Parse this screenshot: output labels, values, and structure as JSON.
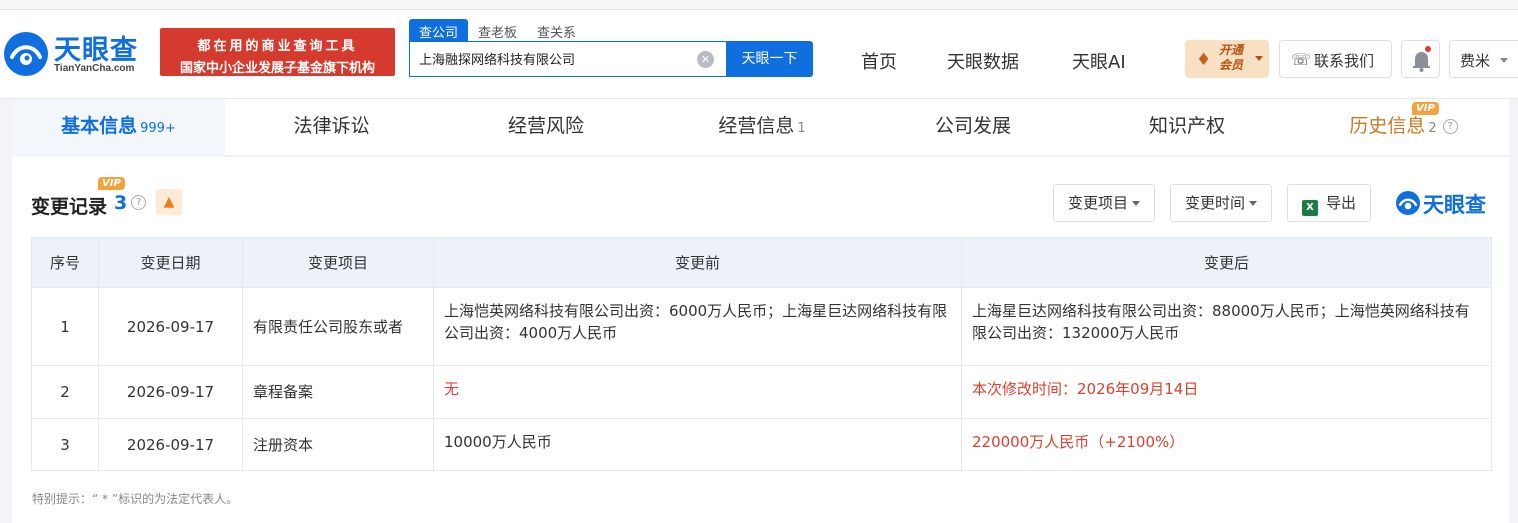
{
  "header": {
    "logo_name": "天眼查",
    "logo_url": "TianYanCha.com",
    "slogan_line1": "都在用的商业查询工具",
    "slogan_line2": "国家中小企业发展子基金旗下机构",
    "search_tabs": [
      "查公司",
      "查老板",
      "查关系"
    ],
    "search_value": "上海融探网络科技有限公司",
    "search_button": "天眼一下",
    "nav": [
      "首页",
      "天眼数据",
      "天眼AI"
    ],
    "vip_open_label": "开通会员",
    "contact_label": "联系我们",
    "user_name": "费米"
  },
  "tabs": [
    {
      "label": "基本信息",
      "count": "999+",
      "active": true
    },
    {
      "label": "法律诉讼",
      "count": ""
    },
    {
      "label": "经营风险",
      "count": ""
    },
    {
      "label": "经营信息",
      "count": "1"
    },
    {
      "label": "公司发展",
      "count": ""
    },
    {
      "label": "知识产权",
      "count": ""
    },
    {
      "label": "历史信息",
      "count": "2",
      "vip": "VIP"
    }
  ],
  "section": {
    "title": "变更记录",
    "count": "3",
    "vip": "VIP",
    "buttons": {
      "change_item": "变更项目",
      "change_time": "变更时间",
      "export": "导出"
    },
    "brand": "天眼查"
  },
  "table": {
    "headers": [
      "序号",
      "变更日期",
      "变更项目",
      "变更前",
      "变更后"
    ],
    "rows": [
      {
        "no": "1",
        "date": "2026-09-17",
        "item": "有限责任公司股东或者",
        "before": "上海恺英网络科技有限公司出资：6000万人民币；上海星巨达网络科技有限公司出资：4000万人民币",
        "after": "上海星巨达网络科技有限公司出资：88000万人民币；上海恺英网络科技有限公司出资：132000万人民币"
      },
      {
        "no": "2",
        "date": "2026-09-17",
        "item": "章程备案",
        "before": "无",
        "after": "本次修改时间：2026年09月14日"
      },
      {
        "no": "3",
        "date": "2026-09-17",
        "item": "注册资本",
        "before": "10000万人民币",
        "after": "220000万人民币（+2100%）"
      }
    ]
  },
  "footnote": "特别提示：“ * ”标识的为法定代表人。",
  "colors": {
    "brand_blue": "#0f6fde",
    "slogan_red": "#d43a2e",
    "highlight_red": "#d8422f",
    "vip_orange": "#f1a43e"
  }
}
